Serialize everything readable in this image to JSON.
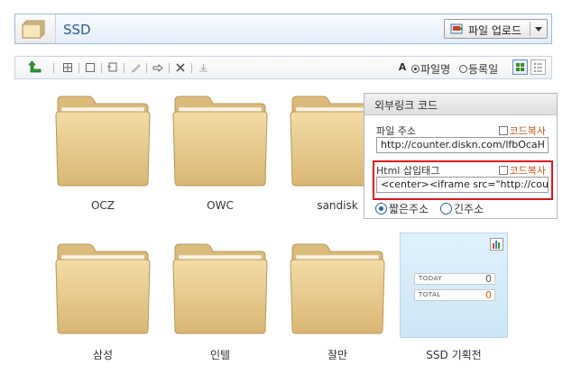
{
  "header": {
    "title": "SSD",
    "upload_label": "파일 업로드"
  },
  "toolbar": {
    "sort_by_name": "파일명",
    "sort_by_date": "등록일",
    "sort_selected": "name",
    "font_icon_label": "A"
  },
  "folders": [
    {
      "name": "OCZ"
    },
    {
      "name": "OWC"
    },
    {
      "name": "sandisk"
    },
    {
      "name": "삼성"
    },
    {
      "name": "인텔"
    },
    {
      "name": "잘만"
    },
    {
      "name": "SSD 기획전"
    }
  ],
  "popup": {
    "title": "외부링크 코드",
    "file_address_label": "파일 주소",
    "copy_code_label": "코드복사",
    "file_address_value": "http://counter.diskn.com/lfbOcaH",
    "html_tag_label": "Html 삽입태그",
    "html_tag_value": "<center><iframe src=\"http://coun",
    "short_url_label": "짧은주소",
    "long_url_label": "긴주소",
    "selected_option": "short"
  },
  "counter": {
    "today_label": "TODAY",
    "today_value": "0",
    "total_label": "TOTAL",
    "total_value": "0",
    "total_color": "#e05a00"
  },
  "colors": {
    "header_title": "#2b5a97",
    "copy_link": "#c0561a",
    "highlight_border": "#e3141a",
    "folder_body": "#e8c98a"
  }
}
